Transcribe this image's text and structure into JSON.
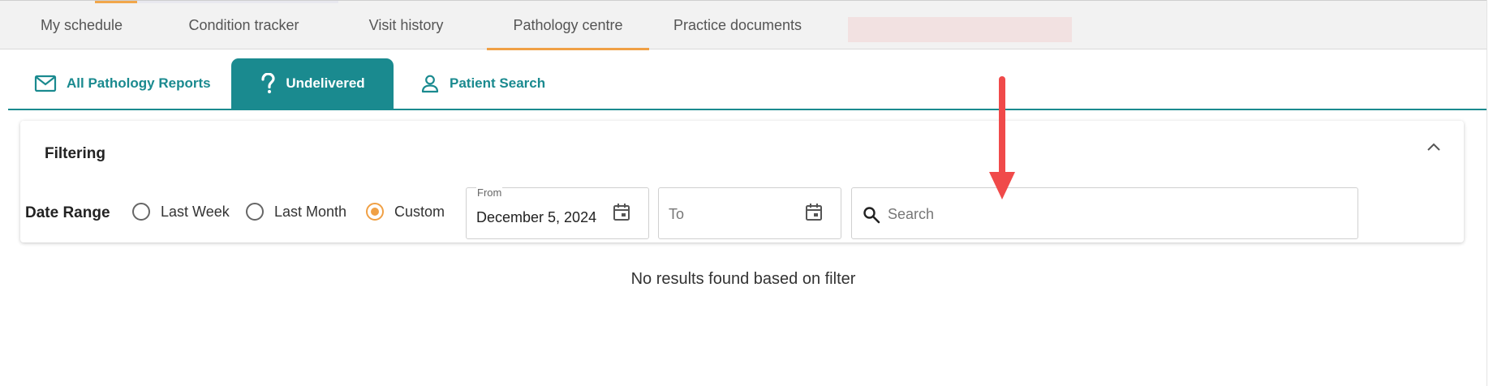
{
  "topnav": {
    "tabs": [
      {
        "label": "My schedule",
        "active": false
      },
      {
        "label": "Condition tracker",
        "active": false
      },
      {
        "label": "Visit history",
        "active": false
      },
      {
        "label": "Pathology centre",
        "active": true
      },
      {
        "label": "Practice documents",
        "active": false
      }
    ],
    "accent_color": "#f0a045"
  },
  "subtabs": [
    {
      "label": "All Pathology Reports",
      "icon": "envelope-icon",
      "active": false
    },
    {
      "label": "Undelivered",
      "icon": "question-mark-icon",
      "active": true
    },
    {
      "label": "Patient Search",
      "icon": "person-icon",
      "active": false
    }
  ],
  "brand_color": "#1a8a8f",
  "filter": {
    "title": "Filtering",
    "date_range_label": "Date Range",
    "options": [
      {
        "label": "Last Week",
        "checked": false
      },
      {
        "label": "Last Month",
        "checked": false
      },
      {
        "label": "Custom",
        "checked": true
      }
    ],
    "from": {
      "label": "From",
      "value": "December 5, 2024"
    },
    "to": {
      "placeholder": "To",
      "value": ""
    },
    "search": {
      "placeholder": "Search",
      "value": ""
    }
  },
  "results": {
    "empty_message": "No results found based on filter"
  },
  "annotation": {
    "type": "arrow",
    "color": "#f04a4a",
    "direction": "down"
  }
}
